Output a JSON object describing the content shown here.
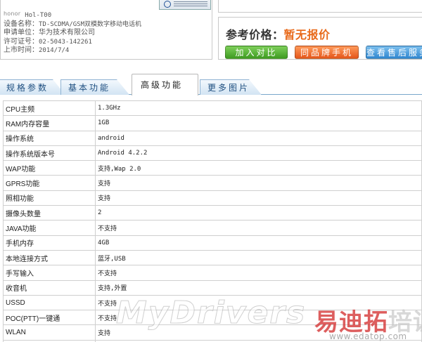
{
  "device": {
    "brand": "honor",
    "model_code": "Hol-T00",
    "specs": [
      {
        "label": "设备名称：",
        "value": "TD-SCDMA/GSM双模数字移动电话机"
      },
      {
        "label": "申请单位：",
        "value": "华为技术有限公司"
      },
      {
        "label": "许可证号：",
        "value": "02-5043-142261"
      },
      {
        "label": "上市时间：",
        "value": "2014/7/4"
      }
    ]
  },
  "price": {
    "label": "参考价格：",
    "value": "暂无报价"
  },
  "buttons": {
    "compare": "加入对比",
    "same_brand": "同品牌手机",
    "service": "查看售后服务"
  },
  "tabs": [
    {
      "label": "规格参数",
      "active": false
    },
    {
      "label": "基本功能",
      "active": false
    },
    {
      "label": "高级功能",
      "active": true
    },
    {
      "label": "更多图片",
      "active": false
    }
  ],
  "table": {
    "rows": [
      {
        "name": "CPU主频",
        "value": "1.3GHz"
      },
      {
        "name": "RAM内存容量",
        "value": "1GB"
      },
      {
        "name": "操作系统",
        "value": "android"
      },
      {
        "name": "操作系统版本号",
        "value": "Android 4.2.2"
      },
      {
        "name": "WAP功能",
        "value": "支持,Wap 2.0"
      },
      {
        "name": "GPRS功能",
        "value": "支持"
      },
      {
        "name": "照相功能",
        "value": "支持"
      },
      {
        "name": "摄像头数量",
        "value": "2"
      },
      {
        "name": "JAVA功能",
        "value": "不支持"
      },
      {
        "name": "手机内存",
        "value": "4GB"
      },
      {
        "name": "本地连接方式",
        "value": "蓝牙,USB"
      },
      {
        "name": "手写输入",
        "value": "不支持"
      },
      {
        "name": "收音机",
        "value": "支持,外置"
      },
      {
        "name": "USSD",
        "value": "不支持"
      },
      {
        "name": "POC(PTT)一键通",
        "value": "不支持"
      },
      {
        "name": "WLAN",
        "value": "支持"
      },
      {
        "name": "",
        "value": ""
      }
    ]
  },
  "watermark": {
    "text": "MyDrivers",
    "cn_part1": "易迪拓",
    "cn_part2": "培训",
    "url": "www.edatop.com"
  },
  "colors": {
    "price_value": "#e86a1b",
    "tab_text": "#1f4f80",
    "btn_green": "#3e9b21",
    "btn_orange": "#e4561a",
    "btn_blue": "#2f86cf"
  }
}
